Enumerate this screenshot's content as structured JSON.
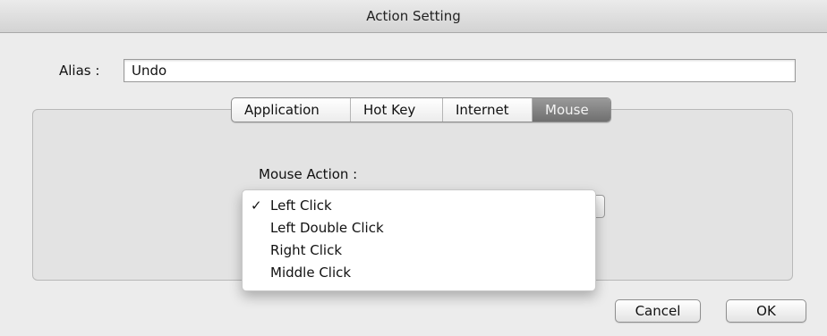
{
  "window": {
    "title": "Action Setting"
  },
  "alias": {
    "label": "Alias :",
    "value": "Undo"
  },
  "tabs": [
    {
      "label": "Application",
      "selected": false
    },
    {
      "label": "Hot Key",
      "selected": false
    },
    {
      "label": "Internet",
      "selected": false
    },
    {
      "label": "Mouse",
      "selected": true
    }
  ],
  "mouse": {
    "label": "Mouse Action :",
    "menu": {
      "checkmark": "✓",
      "items": [
        {
          "label": "Left Click",
          "checked": true
        },
        {
          "label": "Left Double Click",
          "checked": false
        },
        {
          "label": "Right Click",
          "checked": false
        },
        {
          "label": "Middle Click",
          "checked": false
        }
      ]
    }
  },
  "buttons": {
    "cancel": "Cancel",
    "ok": "OK"
  },
  "colors": {
    "selected_tab": "#7b7b7b",
    "window_bg": "#ececec"
  }
}
